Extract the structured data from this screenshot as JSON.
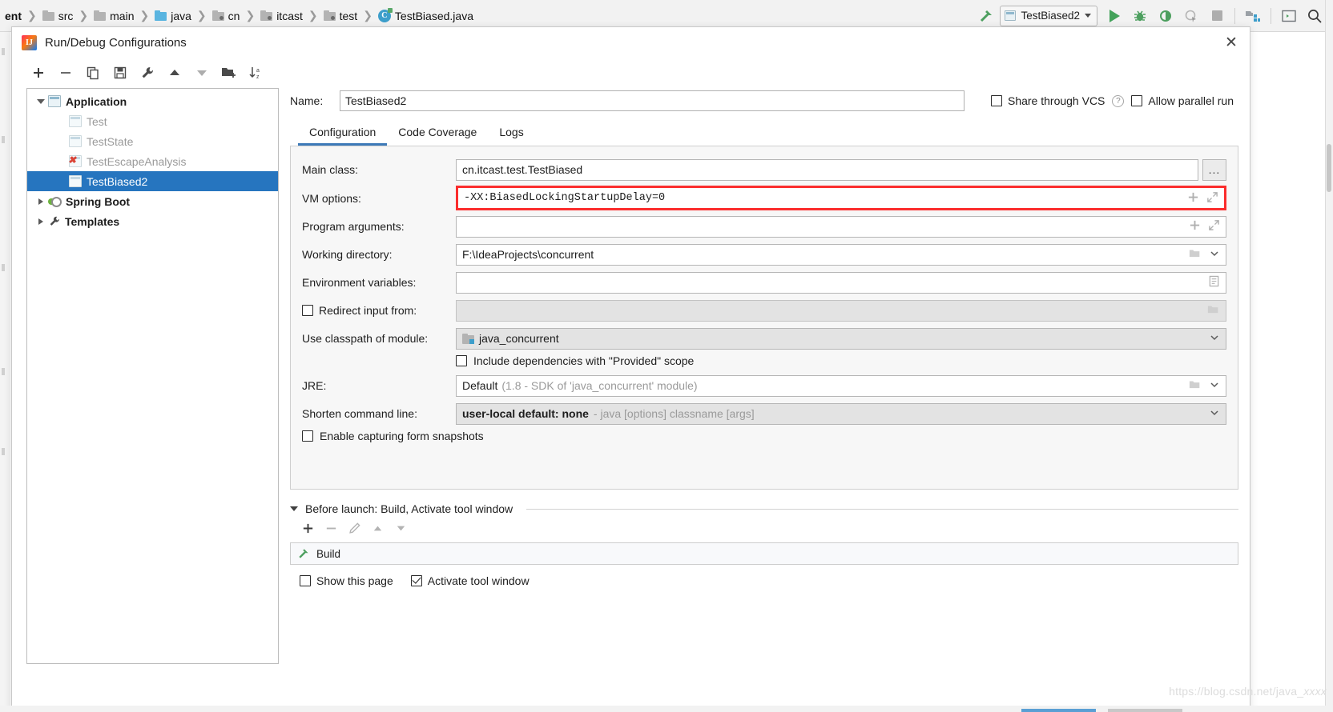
{
  "ide": {
    "breadcrumbs": [
      {
        "label": "ent",
        "icon": "none"
      },
      {
        "label": "src",
        "icon": "folder-gray"
      },
      {
        "label": "main",
        "icon": "folder-gray"
      },
      {
        "label": "java",
        "icon": "folder-blue"
      },
      {
        "label": "cn",
        "icon": "folder-module"
      },
      {
        "label": "itcast",
        "icon": "folder-module"
      },
      {
        "label": "test",
        "icon": "folder-module"
      },
      {
        "label": "TestBiased.java",
        "icon": "java-class"
      }
    ],
    "separator": "❯",
    "toolbar": {
      "build_icon": "hammer-icon",
      "run_config_name": "TestBiased2",
      "run_icon": "run-play-icon",
      "debug_icon": "debug-bug-icon",
      "run_coverage_icon": "run-with-coverage-icon",
      "profiler_icon": "profiler-icon",
      "stop_icon": "stop-icon",
      "project_structure_icon": "project-structure-icon",
      "terminal_icon": "terminal-icon",
      "search_icon": "search-icon"
    }
  },
  "dialog": {
    "title": "Run/Debug Configurations",
    "close_label": "✕",
    "toolbar": [
      {
        "name": "add-configuration",
        "glyph": "+"
      },
      {
        "name": "remove-configuration",
        "glyph": "−"
      },
      {
        "name": "copy-configuration",
        "glyph": "copy-icon"
      },
      {
        "name": "save-configuration",
        "glyph": "save-icon"
      },
      {
        "name": "edit-templates",
        "glyph": "wrench-icon"
      },
      {
        "name": "move-up",
        "glyph": "up-arrow-icon"
      },
      {
        "name": "move-down",
        "glyph": "down-arrow-icon"
      },
      {
        "name": "move-into-folder",
        "glyph": "new-folder-icon"
      },
      {
        "name": "sort-configurations",
        "glyph": "sort-az-icon"
      }
    ],
    "tree": [
      {
        "label": "Application",
        "level": 0,
        "expanded": true,
        "bold": true,
        "icon": "application-icon",
        "selected": false,
        "dim": false
      },
      {
        "label": "Test",
        "level": 1,
        "expanded": null,
        "bold": false,
        "icon": "application-icon",
        "selected": false,
        "dim": true
      },
      {
        "label": "TestState",
        "level": 1,
        "expanded": null,
        "bold": false,
        "icon": "application-icon",
        "selected": false,
        "dim": true
      },
      {
        "label": "TestEscapeAnalysis",
        "level": 1,
        "expanded": null,
        "bold": false,
        "icon": "application-error-icon",
        "selected": false,
        "dim": true
      },
      {
        "label": "TestBiased2",
        "level": 1,
        "expanded": null,
        "bold": false,
        "icon": "application-icon",
        "selected": true,
        "dim": false
      },
      {
        "label": "Spring Boot",
        "level": 0,
        "expanded": false,
        "bold": true,
        "icon": "spring-boot-icon",
        "selected": false,
        "dim": false
      },
      {
        "label": "Templates",
        "level": 0,
        "expanded": false,
        "bold": true,
        "icon": "wrench-icon",
        "selected": false,
        "dim": false
      }
    ],
    "name": {
      "label": "Name:",
      "value": "TestBiased2"
    },
    "share_through_vcs": {
      "label": "Share through VCS",
      "checked": false,
      "help": "?"
    },
    "allow_parallel_run": {
      "label": "Allow parallel run",
      "checked": false
    },
    "tabs": [
      {
        "label": "Configuration",
        "active": true
      },
      {
        "label": "Code Coverage",
        "active": false
      },
      {
        "label": "Logs",
        "active": false
      }
    ],
    "fields": {
      "main_class": {
        "label": "Main class:",
        "value": "cn.itcast.test.TestBiased",
        "browse": "..."
      },
      "vm_options": {
        "label": "VM options:",
        "value": "-XX:BiasedLockingStartupDelay=0",
        "highlighted": true,
        "highlight_color": "#fb2d2d"
      },
      "program_arguments": {
        "label": "Program arguments:",
        "value": ""
      },
      "working_directory": {
        "label": "Working directory:",
        "value": "F:\\IdeaProjects\\concurrent"
      },
      "environment_variables": {
        "label": "Environment variables:",
        "value": ""
      },
      "redirect_input_from": {
        "label": "Redirect input from:",
        "checked": false,
        "value": ""
      },
      "use_classpath_of_module": {
        "label": "Use classpath of module:",
        "value": "java_concurrent"
      },
      "include_provided_scope": {
        "label": "Include dependencies with \"Provided\" scope",
        "checked": false
      },
      "jre": {
        "label": "JRE:",
        "value": "Default",
        "hint": "(1.8 - SDK of 'java_concurrent' module)"
      },
      "shorten_command_line": {
        "label": "Shorten command line:",
        "value": "user-local default: none",
        "hint": "- java [options] classname [args]"
      },
      "enable_form_snapshots": {
        "label": "Enable capturing form snapshots",
        "checked": false
      }
    },
    "before_launch": {
      "header": "Before launch: Build, Activate tool window",
      "tools": [
        {
          "name": "add-task",
          "glyph": "+"
        },
        {
          "name": "remove-task",
          "glyph": "−"
        },
        {
          "name": "edit-task",
          "glyph": "pencil-icon"
        },
        {
          "name": "move-task-up",
          "glyph": "up-arrow-icon"
        },
        {
          "name": "move-task-down",
          "glyph": "down-arrow-icon"
        }
      ],
      "items": [
        {
          "label": "Build",
          "icon": "hammer-icon"
        }
      ],
      "show_this_page": {
        "label": "Show this page",
        "checked": false
      },
      "activate_tool_window": {
        "label": "Activate tool window",
        "checked": true
      }
    }
  },
  "watermark": {
    "prefix": "https://blog.csdn.net/java_",
    "suffix": "xxxx"
  }
}
